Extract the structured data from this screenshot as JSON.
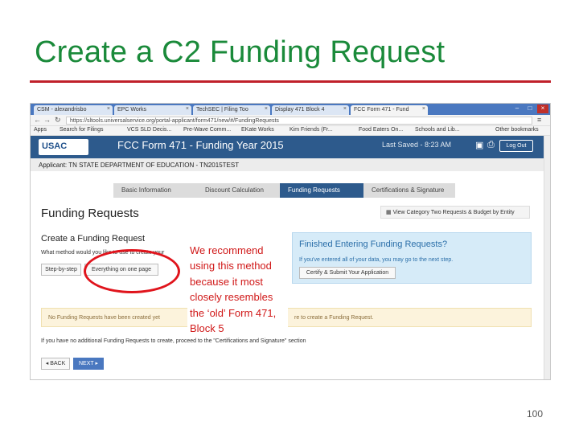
{
  "slide": {
    "title": "Create a C2 Funding Request",
    "page_number": "100",
    "callout_text": "We recommend using this method because it most closely resembles the ‘old’ Form 471, Block 5"
  },
  "browser": {
    "tabs": [
      {
        "label": "CSM - alexandrisbo",
        "active": false
      },
      {
        "label": "EPC Works",
        "active": false
      },
      {
        "label": "TechSEC | Filing Too",
        "active": false
      },
      {
        "label": "Display 471 Block 4",
        "active": false
      },
      {
        "label": "FCC Form 471 - Fund",
        "active": true
      }
    ],
    "url": "https://sltools.universalservice.org/portal-applicant/form471/new/#/FundingRequests",
    "bookmarks": [
      "Apps",
      "Search for Filings",
      "VCS SLD Decis...",
      "Pre-Wave Comm...",
      "EKate Works",
      "Kim Friends (Fr...",
      "Food Eaters On...",
      "Schools and Lib...",
      "Other bookmarks"
    ]
  },
  "app": {
    "logo": "USAC",
    "logo_sub": "Universal Service Administrative Co.",
    "form_title": "FCC Form 471 - Funding Year 2015",
    "last_saved": "Last Saved - 8:23 AM",
    "logout_label": "Log Out",
    "applicant": "Applicant: TN STATE DEPARTMENT OF EDUCATION - TN2015TEST",
    "steps": [
      {
        "label": "Basic Information",
        "active": false
      },
      {
        "label": "Discount Calculation",
        "active": false
      },
      {
        "label": "Funding Requests",
        "active": true
      },
      {
        "label": "Certifications & Signature",
        "active": false
      }
    ],
    "page_heading": "Funding Requests",
    "view_category_label": "View Category Two Requests & Budget by Entity",
    "create_heading": "Create a Funding Request",
    "method_question": "What method would you like to use to create your",
    "step_by_step_label": "Step-by-step",
    "everything_label": "Everything on one page",
    "finished_heading": "Finished Entering Funding Requests?",
    "finished_text": "If you've entered all of your data, you may go to the next step.",
    "certify_label": "Certify & Submit Your Application",
    "notice_left": "No Funding Requests have been created yet",
    "notice_right": "re to create a Funding Request.",
    "proceed_text": "If you have no additional Funding Requests to create, proceed to the \"Certifications and Signature\" section",
    "back_label": "◂ BACK",
    "next_label": "NEXT ▸"
  },
  "colors": {
    "title_green": "#1a8a3a",
    "rule_red": "#c0202a",
    "callout_red": "#d01818",
    "usac_blue": "#2d5a8c"
  }
}
